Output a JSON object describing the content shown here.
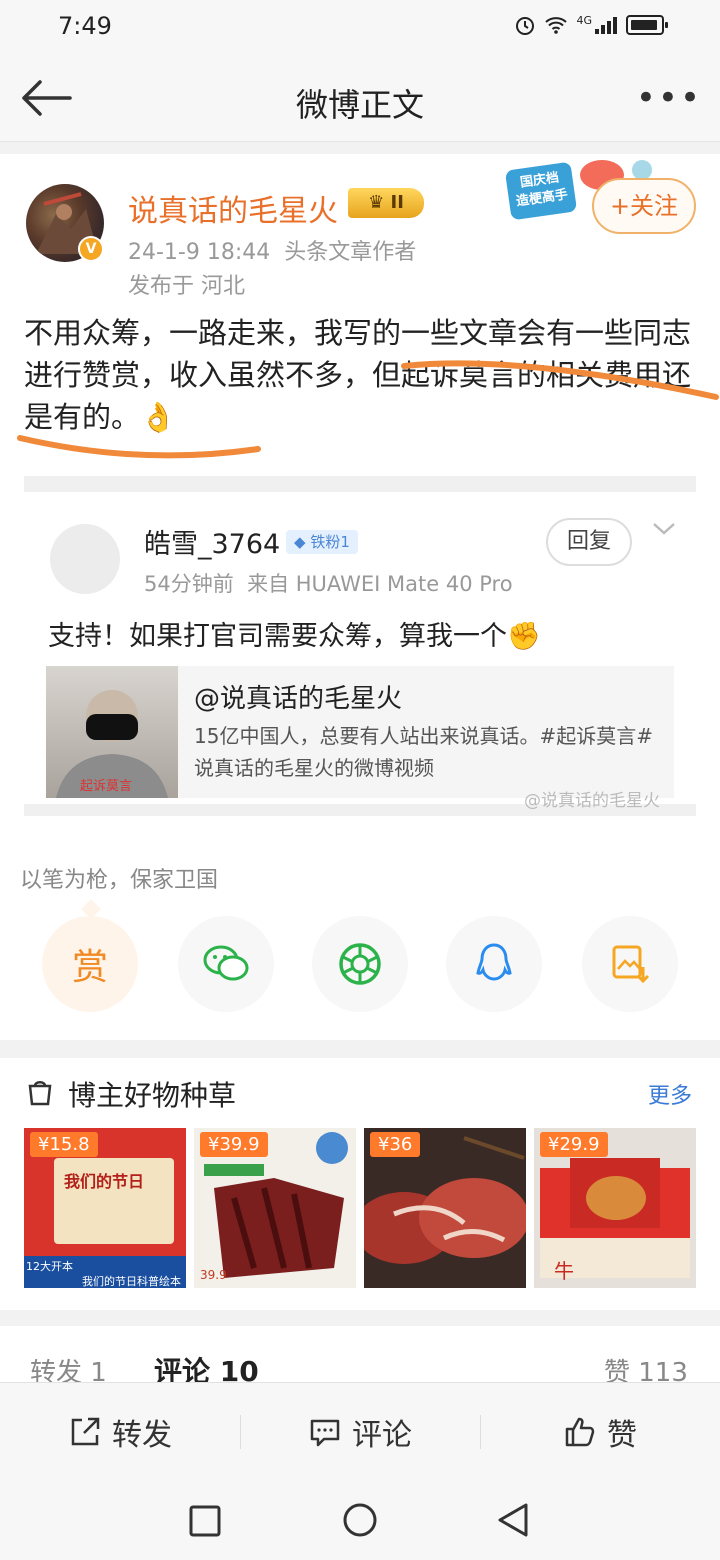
{
  "status_bar": {
    "time": "7:49",
    "network": "4G"
  },
  "header": {
    "title": "微博正文"
  },
  "post": {
    "author": "说真话的毛星火",
    "level_badge": "II",
    "promo_badge": "国庆档\n造梗高手",
    "avatar_badge": "V",
    "follow_label": "+关注",
    "time_source": "24-1-9 18:44  头条文章作者",
    "location": "发布于 河北",
    "text": "不用众筹，一路走来，我写的一些文章会有一些同志进行赞赏，收入虽然不多，但起诉莫言的相关费用还是有的。👌"
  },
  "repost": {
    "commenter": "皓雪_3764",
    "fan_badge": "铁粉1",
    "time_source": "54分钟前  来自 HUAWEI Mate 40 Pro",
    "reply_label": "回复",
    "text": "支持！如果打官司需要众筹，算我一个✊",
    "link_card": {
      "title": "@说真话的毛星火",
      "description": "15亿中国人，总要有人站出来说真话。#起诉莫言# 说真话的毛星火的微博视频"
    },
    "watermark": "@说真话的毛星火"
  },
  "tagline": "以笔为枪，保家卫国",
  "share": {
    "reward_label": "赏"
  },
  "shop": {
    "title": "博主好物种草",
    "more_label": "更多",
    "products": [
      {
        "price": "¥15.8",
        "caption_1": "12大开本",
        "caption_2": "我们的节日科普绘本",
        "book_title": "我们的节日"
      },
      {
        "price": "¥39.9",
        "caption_1": "39.9"
      },
      {
        "price": "¥36"
      },
      {
        "price": "¥29.9"
      }
    ]
  },
  "tabs": {
    "repost": "转发 1",
    "comment": "评论 10",
    "like": "赞 113"
  },
  "actions": {
    "repost": "转发",
    "comment": "评论",
    "like": "赞"
  },
  "colors": {
    "accent_orange": "#e8702a",
    "link_blue": "#3a7bd5",
    "highlight_underline": "#f08a3a"
  }
}
